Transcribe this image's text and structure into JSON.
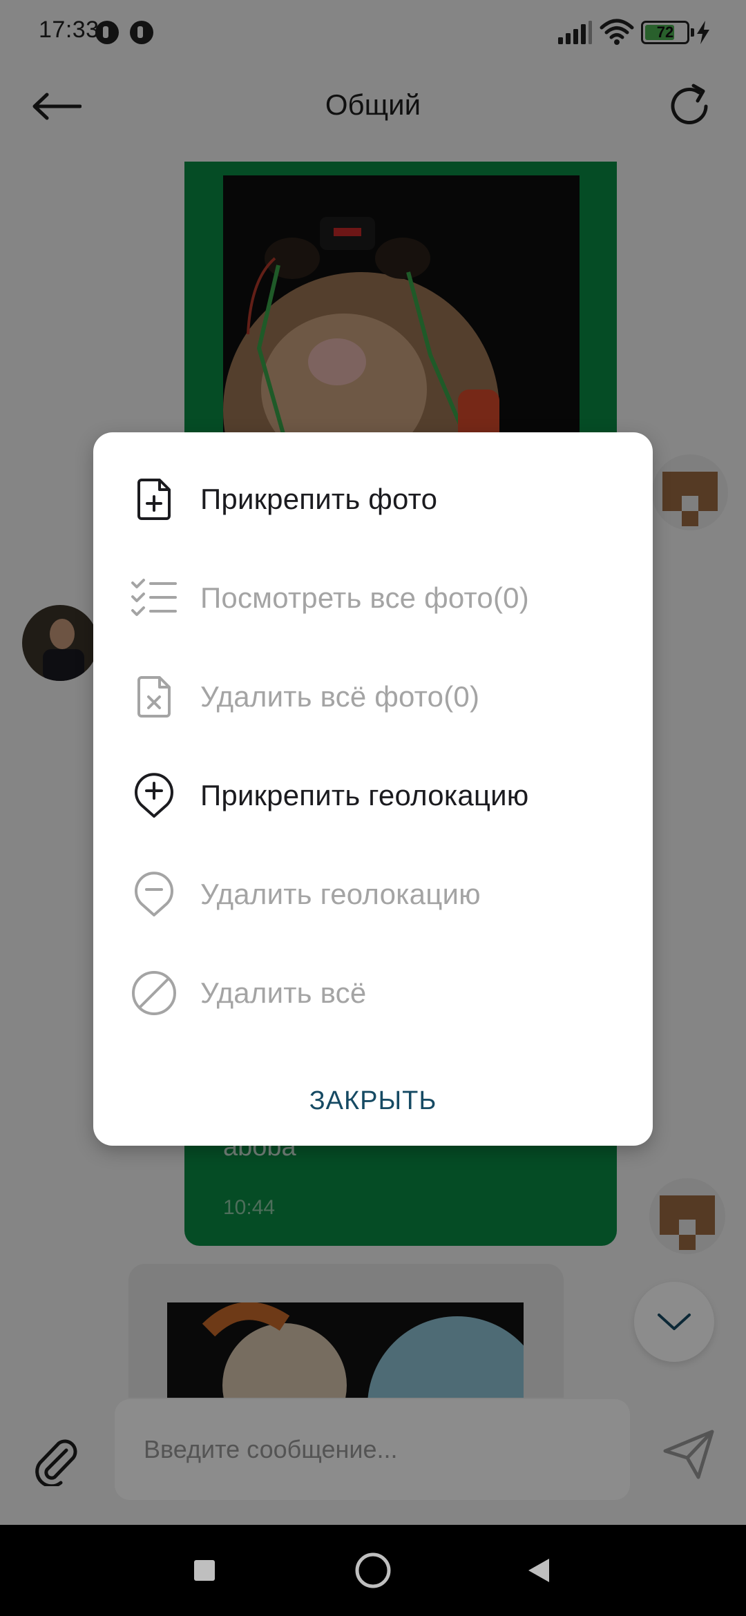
{
  "status_bar": {
    "time": "17:33",
    "battery_level": "72",
    "battery_fraction": 0.72,
    "charging": true,
    "icons": [
      "notification-icon",
      "notification-icon",
      "signal-icon",
      "wifi-icon",
      "battery-icon",
      "charging-icon"
    ]
  },
  "header": {
    "title": "Общий",
    "back_icon": "arrow-left-icon",
    "refresh_icon": "refresh-icon"
  },
  "chat": {
    "sent_message": {
      "text": "aboba",
      "time": "10:44"
    },
    "scroll_down_icon": "chevron-down-icon"
  },
  "input": {
    "placeholder": "Введите сообщение...",
    "attach_icon": "paperclip-icon",
    "send_icon": "send-icon"
  },
  "dialog": {
    "items": [
      {
        "label": "Прикрепить фото",
        "icon": "file-plus-icon",
        "enabled": true
      },
      {
        "label": "Посмотреть все фото(0)",
        "icon": "checklist-icon",
        "enabled": false
      },
      {
        "label": "Удалить всё фото(0)",
        "icon": "file-remove-icon",
        "enabled": false
      },
      {
        "label": "Прикрепить геолокацию",
        "icon": "location-plus-icon",
        "enabled": true
      },
      {
        "label": "Удалить геолокацию",
        "icon": "location-minus-icon",
        "enabled": false
      },
      {
        "label": "Удалить всё",
        "icon": "block-icon",
        "enabled": false
      }
    ],
    "close_label": "ЗАКРЫТЬ"
  },
  "colors": {
    "sent_bubble": "#0a8a44",
    "accent_text": "#164a63",
    "disabled_text": "#a4a4a4"
  }
}
